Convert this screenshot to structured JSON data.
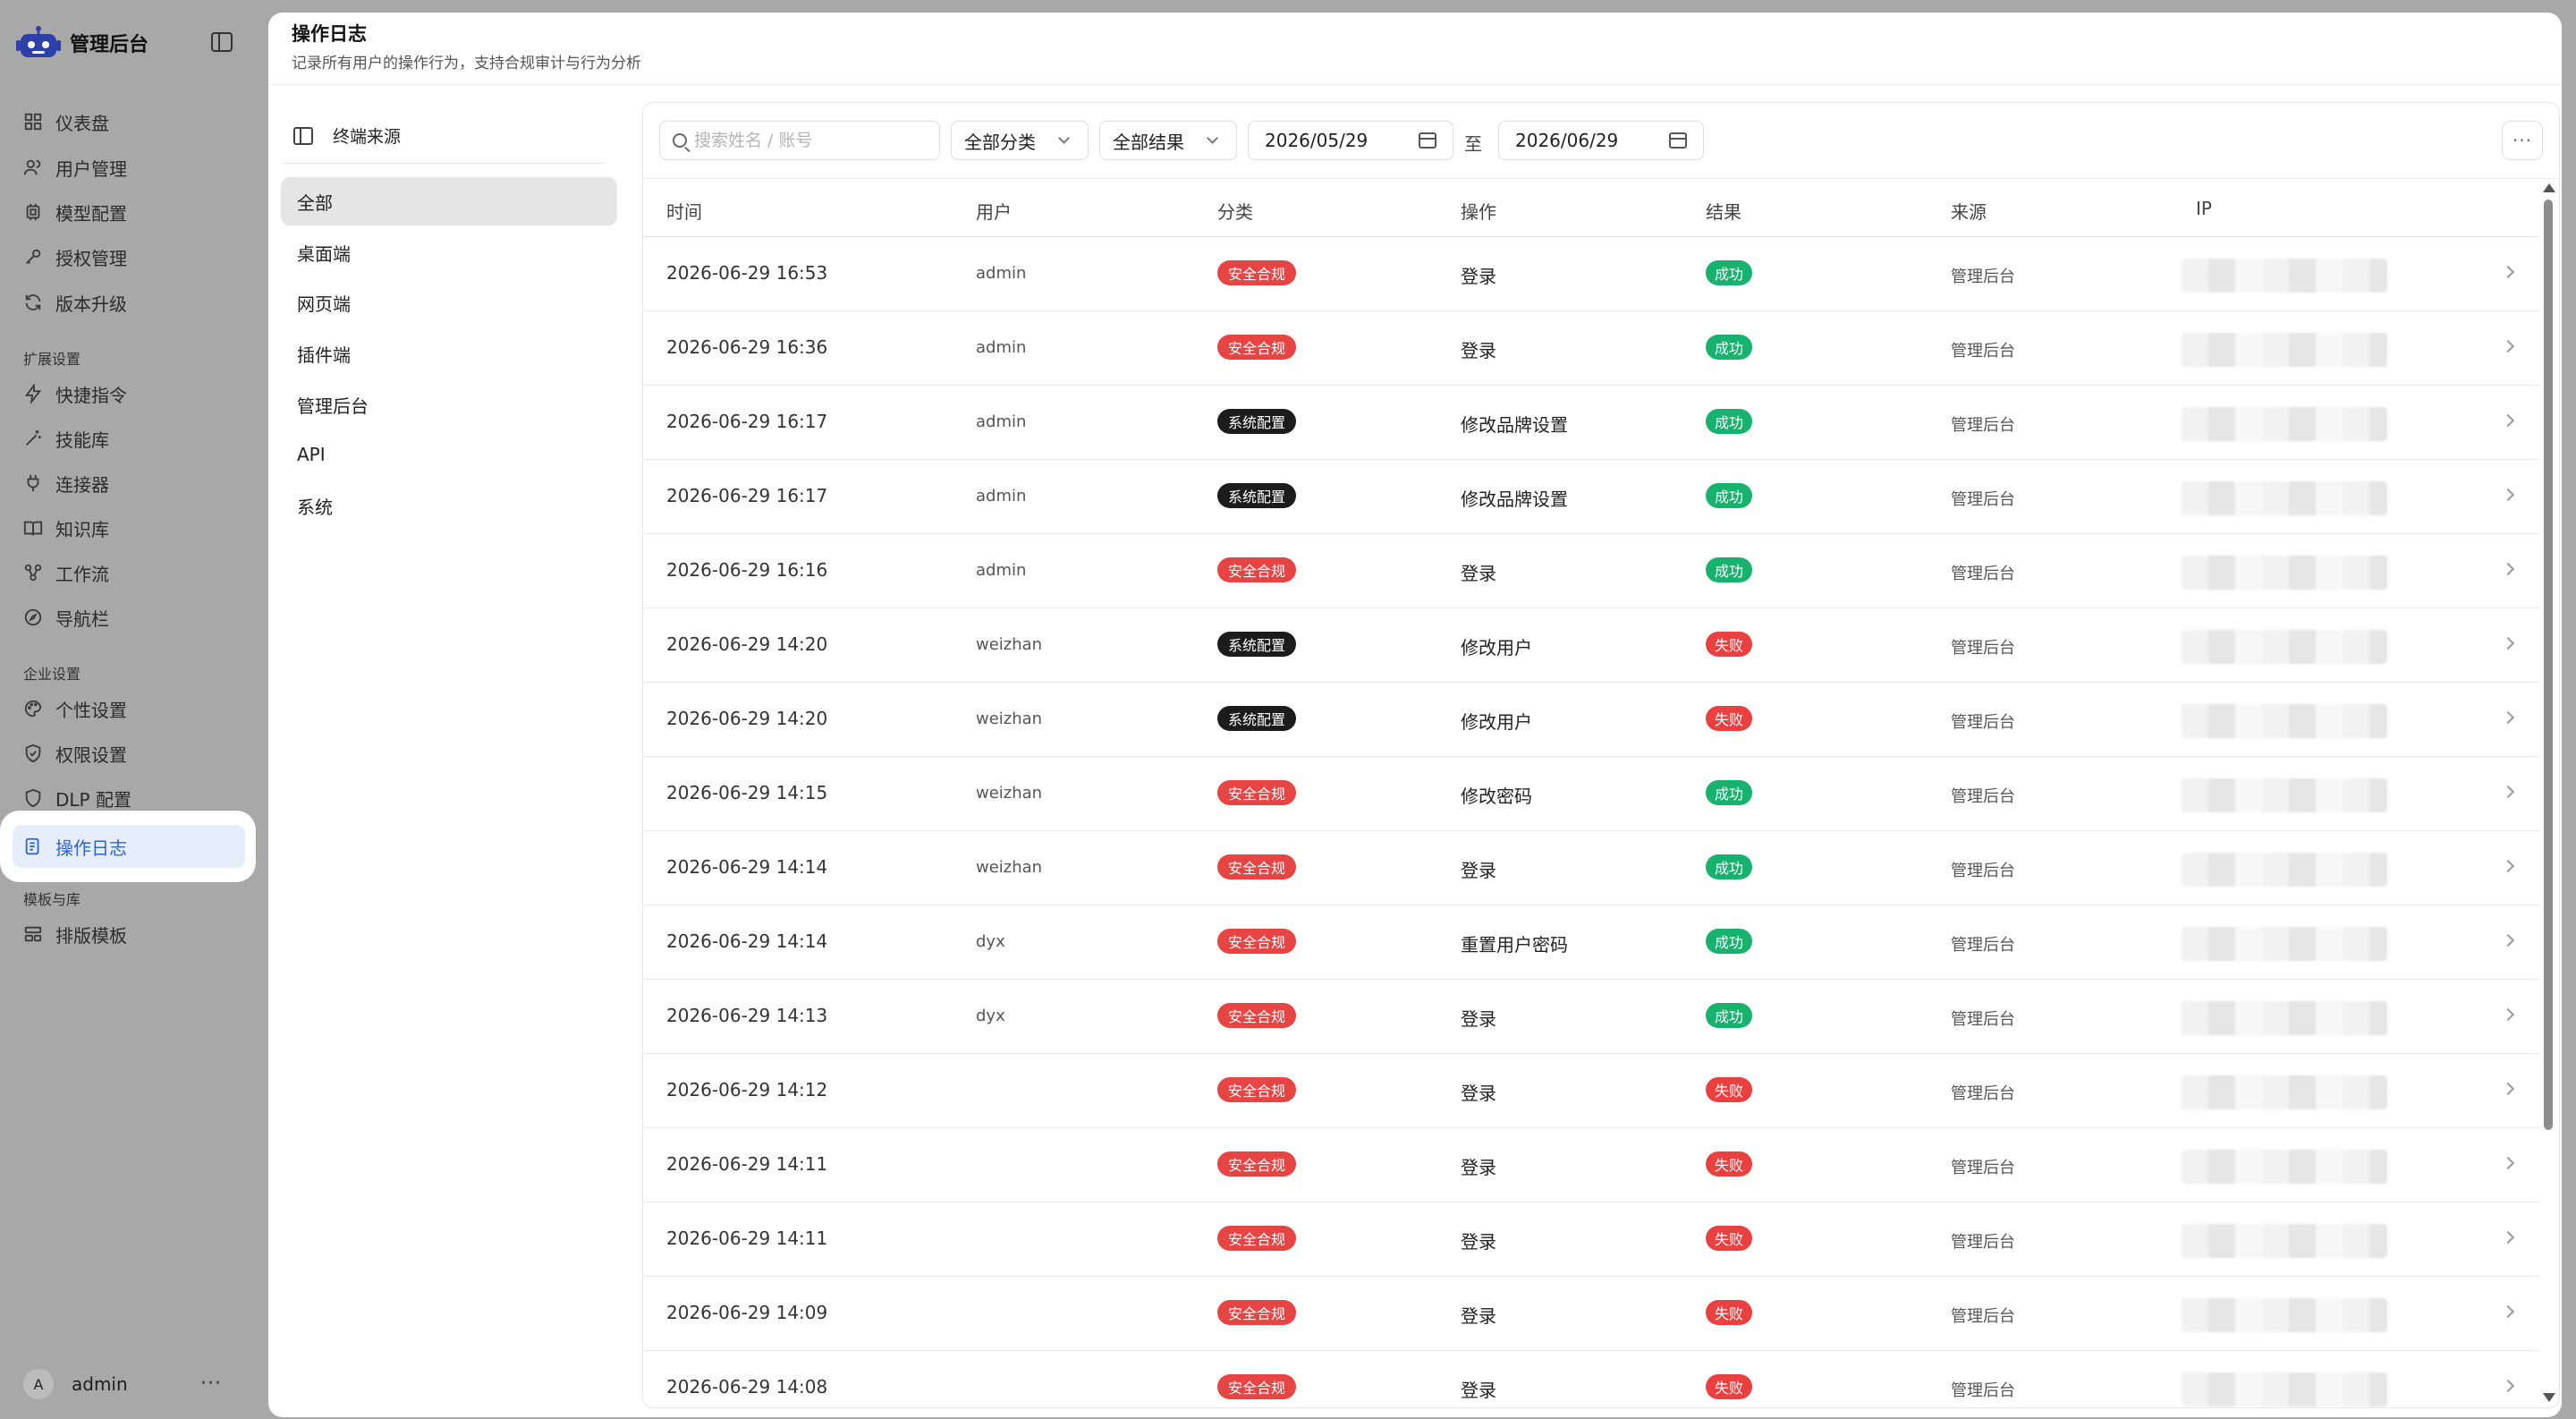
{
  "app": {
    "title": "管理后台"
  },
  "sidebar": {
    "items_main": [
      {
        "label": "仪表盘",
        "icon": "dashboard-icon"
      },
      {
        "label": "用户管理",
        "icon": "users-icon"
      },
      {
        "label": "模型配置",
        "icon": "chip-icon"
      },
      {
        "label": "授权管理",
        "icon": "key-icon"
      },
      {
        "label": "版本升级",
        "icon": "refresh-icon"
      }
    ],
    "group_ext": "扩展设置",
    "items_ext": [
      {
        "label": "快捷指令",
        "icon": "lightning-icon"
      },
      {
        "label": "技能库",
        "icon": "wand-icon"
      },
      {
        "label": "连接器",
        "icon": "plug-icon"
      },
      {
        "label": "知识库",
        "icon": "book-icon"
      },
      {
        "label": "工作流",
        "icon": "workflow-icon"
      },
      {
        "label": "导航栏",
        "icon": "compass-icon"
      }
    ],
    "group_ent": "企业设置",
    "items_ent": [
      {
        "label": "个性设置",
        "icon": "palette-icon"
      },
      {
        "label": "权限设置",
        "icon": "shield-check-icon"
      },
      {
        "label": "DLP 配置",
        "icon": "shield-icon"
      },
      {
        "label": "操作日志",
        "icon": "log-icon"
      }
    ],
    "group_tpl": "模板与库",
    "items_tpl": [
      {
        "label": "排版模板",
        "icon": "layout-icon"
      }
    ],
    "user": {
      "avatar": "A",
      "name": "admin",
      "more": "···"
    }
  },
  "page": {
    "title": "操作日志",
    "subtitle": "记录所有用户的操作行为，支持合规审计与行为分析"
  },
  "filter": {
    "title": "终端来源",
    "items": [
      "全部",
      "桌面端",
      "网页端",
      "插件端",
      "管理后台",
      "API",
      "系统"
    ]
  },
  "toolbar": {
    "search_placeholder": "搜索姓名 / 账号",
    "category": "全部分类",
    "result": "全部结果",
    "date_from": "2026/05/29",
    "date_sep": "至",
    "date_to": "2026/06/29",
    "more": "···"
  },
  "table": {
    "headers": [
      "时间",
      "用户",
      "分类",
      "操作",
      "结果",
      "来源",
      "IP"
    ],
    "rows": [
      {
        "time": "2026-06-29 16:53",
        "user": "admin",
        "category": "安全合规",
        "cat_style": "red",
        "op": "登录",
        "result": "成功",
        "res_style": "ok",
        "source": "管理后台"
      },
      {
        "time": "2026-06-29 16:36",
        "user": "admin",
        "category": "安全合规",
        "cat_style": "red",
        "op": "登录",
        "result": "成功",
        "res_style": "ok",
        "source": "管理后台"
      },
      {
        "time": "2026-06-29 16:17",
        "user": "admin",
        "category": "系统配置",
        "cat_style": "dark",
        "op": "修改品牌设置",
        "result": "成功",
        "res_style": "ok",
        "source": "管理后台"
      },
      {
        "time": "2026-06-29 16:17",
        "user": "admin",
        "category": "系统配置",
        "cat_style": "dark",
        "op": "修改品牌设置",
        "result": "成功",
        "res_style": "ok",
        "source": "管理后台"
      },
      {
        "time": "2026-06-29 16:16",
        "user": "admin",
        "category": "安全合规",
        "cat_style": "red",
        "op": "登录",
        "result": "成功",
        "res_style": "ok",
        "source": "管理后台"
      },
      {
        "time": "2026-06-29 14:20",
        "user": "weizhan",
        "category": "系统配置",
        "cat_style": "dark",
        "op": "修改用户",
        "result": "失败",
        "res_style": "fail",
        "source": "管理后台"
      },
      {
        "time": "2026-06-29 14:20",
        "user": "weizhan",
        "category": "系统配置",
        "cat_style": "dark",
        "op": "修改用户",
        "result": "失败",
        "res_style": "fail",
        "source": "管理后台"
      },
      {
        "time": "2026-06-29 14:15",
        "user": "weizhan",
        "category": "安全合规",
        "cat_style": "red",
        "op": "修改密码",
        "result": "成功",
        "res_style": "ok",
        "source": "管理后台"
      },
      {
        "time": "2026-06-29 14:14",
        "user": "weizhan",
        "category": "安全合规",
        "cat_style": "red",
        "op": "登录",
        "result": "成功",
        "res_style": "ok",
        "source": "管理后台"
      },
      {
        "time": "2026-06-29 14:14",
        "user": "dyx",
        "category": "安全合规",
        "cat_style": "red",
        "op": "重置用户密码",
        "result": "成功",
        "res_style": "ok",
        "source": "管理后台"
      },
      {
        "time": "2026-06-29 14:13",
        "user": "dyx",
        "category": "安全合规",
        "cat_style": "red",
        "op": "登录",
        "result": "成功",
        "res_style": "ok",
        "source": "管理后台"
      },
      {
        "time": "2026-06-29 14:12",
        "user": "",
        "category": "安全合规",
        "cat_style": "red",
        "op": "登录",
        "result": "失败",
        "res_style": "fail",
        "source": "管理后台"
      },
      {
        "time": "2026-06-29 14:11",
        "user": "",
        "category": "安全合规",
        "cat_style": "red",
        "op": "登录",
        "result": "失败",
        "res_style": "fail",
        "source": "管理后台"
      },
      {
        "time": "2026-06-29 14:11",
        "user": "",
        "category": "安全合规",
        "cat_style": "red",
        "op": "登录",
        "result": "失败",
        "res_style": "fail",
        "source": "管理后台"
      },
      {
        "time": "2026-06-29 14:09",
        "user": "",
        "category": "安全合规",
        "cat_style": "red",
        "op": "登录",
        "result": "失败",
        "res_style": "fail",
        "source": "管理后台"
      },
      {
        "time": "2026-06-29 14:08",
        "user": "",
        "category": "安全合规",
        "cat_style": "red",
        "op": "登录",
        "result": "失败",
        "res_style": "fail",
        "source": "管理后台"
      }
    ]
  },
  "colors": {
    "accent": "#2f62e0",
    "danger": "#e74444",
    "success": "#18b26f",
    "dark_badge": "#1c1c1c"
  }
}
